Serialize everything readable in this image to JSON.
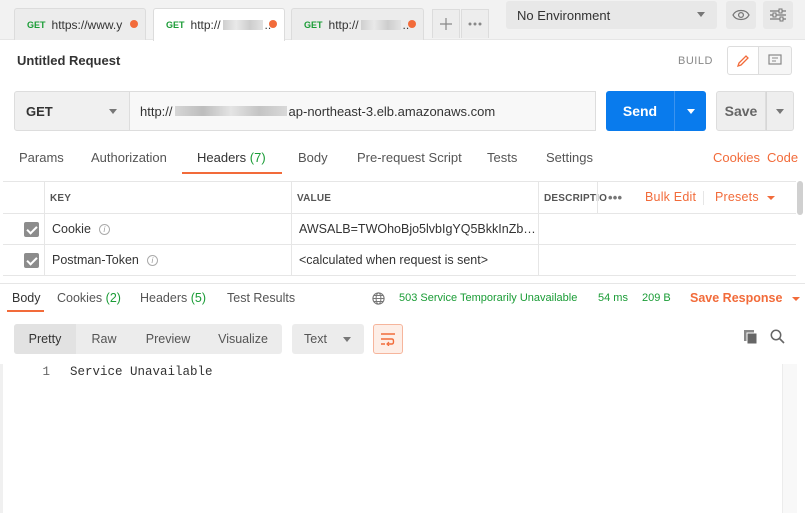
{
  "tabs": [
    {
      "method": "GET",
      "url_prefix": "https://www.y",
      "url_suffix": "",
      "active": false
    },
    {
      "method": "GET",
      "url_prefix": "http://",
      "url_suffix": "..",
      "active": true
    },
    {
      "method": "GET",
      "url_prefix": "http://",
      "url_suffix": "..",
      "active": false
    }
  ],
  "environment": {
    "selected": "No Environment"
  },
  "request": {
    "title": "Untitled Request",
    "build_label": "BUILD",
    "method": "GET",
    "url_prefix": "http://",
    "url_suffix": "ap-northeast-3.elb.amazonaws.com",
    "send_label": "Send",
    "save_label": "Save"
  },
  "request_tabs": {
    "params": "Params",
    "authorization": "Authorization",
    "headers": "Headers",
    "headers_count": "(7)",
    "body": "Body",
    "prerequest": "Pre-request Script",
    "tests": "Tests",
    "settings": "Settings",
    "cookies": "Cookies",
    "code": "Code"
  },
  "headers_table": {
    "col_key": "KEY",
    "col_value": "VALUE",
    "col_description": "DESCRIPTIO",
    "more": "•••",
    "bulk_edit": "Bulk Edit",
    "presets": "Presets",
    "rows": [
      {
        "key": "Cookie",
        "value": "AWSALB=TWOhoBjo5lvbIgYQ5BkkInZbxl..."
      },
      {
        "key": "Postman-Token",
        "value": "<calculated when request is sent>"
      }
    ]
  },
  "response": {
    "tabs": {
      "body": "Body",
      "cookies": "Cookies",
      "cookies_count": "(2)",
      "headers": "Headers",
      "headers_count": "(5)",
      "test_results": "Test Results"
    },
    "status": "503 Service Temporarily Unavailable",
    "time": "54 ms",
    "size": "209 B",
    "save_response": "Save Response",
    "view_modes": [
      "Pretty",
      "Raw",
      "Preview",
      "Visualize"
    ],
    "format": "Text",
    "line_number": "1",
    "body_text": "Service Unavailable"
  },
  "colors": {
    "accent": "#f26b3a",
    "primary": "#097bed",
    "success": "#1a9c36"
  }
}
